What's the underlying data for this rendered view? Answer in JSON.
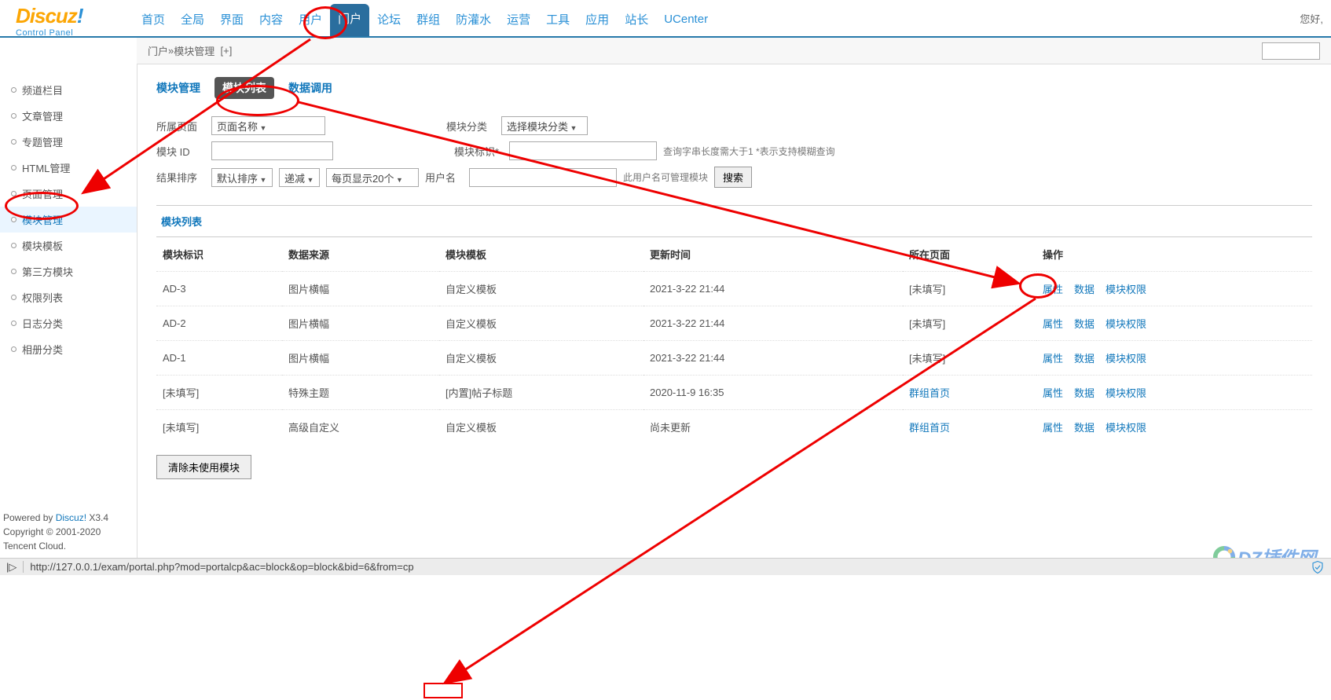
{
  "brand": {
    "name": "Discuz!",
    "subtitle": "Control Panel"
  },
  "greeting": "您好,",
  "nav": [
    "首页",
    "全局",
    "界面",
    "内容",
    "用户",
    "门户",
    "论坛",
    "群组",
    "防灌水",
    "运营",
    "工具",
    "应用",
    "站长",
    "UCenter"
  ],
  "nav_active_index": 5,
  "breadcrumb": {
    "a": "门户",
    "sep": " » ",
    "b": "模块管理",
    "plus": "[+]"
  },
  "sidebar": {
    "items": [
      "频道栏目",
      "文章管理",
      "专题管理",
      "HTML管理",
      "页面管理",
      "模块管理",
      "模块模板",
      "第三方模块",
      "权限列表",
      "日志分类",
      "相册分类"
    ],
    "active_index": 5
  },
  "tabs": {
    "items": [
      "模块管理",
      "模块列表",
      "数据调用"
    ],
    "active_index": 1
  },
  "filters": {
    "page_label": "所属页面",
    "page_select": "页面名称",
    "category_label": "模块分类",
    "category_select": "选择模块分类",
    "module_id_label": "模块 ID",
    "module_tag_label": "模块标识*",
    "tag_hint": "查询字串长度需大于1   *表示支持模糊查询",
    "sort_label": "结果排序",
    "sort_select": "默认排序",
    "sort_dir": "递减",
    "perpage": "每页显示20个",
    "user_label": "用户名",
    "user_hint": "此用户名可管理模块",
    "search_btn": "搜索"
  },
  "list_title": "模块列表",
  "table": {
    "headers": [
      "模块标识",
      "数据来源",
      "模块模板",
      "更新时间",
      "所在页面",
      "操作"
    ],
    "ops": [
      "属性",
      "数据",
      "模块权限"
    ],
    "rows": [
      {
        "id": "AD-3",
        "src": "图片横幅",
        "tpl": "自定义模板",
        "time": "2021-3-22 21:44",
        "page": "[未填写]",
        "page_link": false
      },
      {
        "id": "AD-2",
        "src": "图片横幅",
        "tpl": "自定义模板",
        "time": "2021-3-22 21:44",
        "page": "[未填写]",
        "page_link": false
      },
      {
        "id": "AD-1",
        "src": "图片横幅",
        "tpl": "自定义模板",
        "time": "2021-3-22 21:44",
        "page": "[未填写]",
        "page_link": false
      },
      {
        "id": "[未填写]",
        "src": "特殊主题",
        "tpl": "[内置]帖子标题",
        "time": "2020-11-9 16:35",
        "page": "群组首页",
        "page_link": true
      },
      {
        "id": "[未填写]",
        "src": "高级自定义",
        "tpl": "自定义模板",
        "time": "尚未更新",
        "page": "群组首页",
        "page_link": true
      }
    ]
  },
  "clear_btn": "清除未使用模块",
  "footer": {
    "l1a": "Powered by ",
    "l1b": "Discuz!",
    "l1c": " X3.4",
    "l2": "Copyright © 2001-2020",
    "l3": "Tencent Cloud."
  },
  "statusbar": {
    "arrow": "|▷",
    "url": "http://127.0.0.1/exam/portal.php?mod=portalcp&ac=block&op=block&bid=6&from=cp"
  },
  "watermark": "DZ插件网"
}
